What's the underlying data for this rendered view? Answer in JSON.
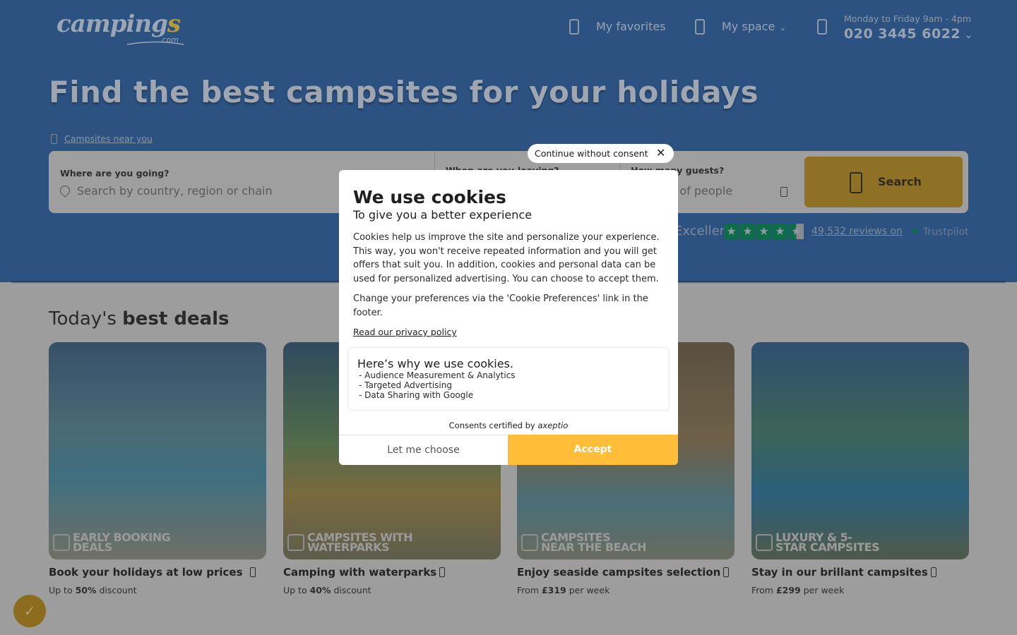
{
  "header": {
    "logo_main": "camping",
    "logo_s": "s",
    "logo_com": ".com",
    "favorites_label": "My favorites",
    "space_label": "My space",
    "hours": "Monday to Friday 9am - 4pm",
    "phone": "020 3445 6022"
  },
  "hero": {
    "title": "Find the best campsites for your holidays",
    "near_link": "Campsites near you"
  },
  "search": {
    "where_label": "Where are you going?",
    "where_placeholder": "Search by country, region or chain",
    "when_label": "When are you leaving?",
    "guests_label": "How many guests?",
    "guests_placeholder": "Number of people",
    "button_label": "Search"
  },
  "trust": {
    "rating_word": "Excellent",
    "reviews_text": "49,532 reviews on",
    "platform": "Trustpilot"
  },
  "deals": {
    "title_light": "Today's ",
    "title_bold": "best deals",
    "cards": [
      {
        "badge": "EARLY BOOKING DEALS",
        "title": "Book your holidays at low prices",
        "sub_prefix": "Up to ",
        "sub_value": "50%",
        "sub_suffix": " discount"
      },
      {
        "badge": "CAMPSITES WITH WATERPARKS",
        "title": "Camping with waterparks",
        "sub_prefix": "Up to ",
        "sub_value": "40%",
        "sub_suffix": " discount"
      },
      {
        "badge": "CAMPSITES NEAR THE BEACH",
        "title": "Enjoy seaside campsites selection",
        "sub_prefix": "From ",
        "sub_value": "£319",
        "sub_suffix": " per week"
      },
      {
        "badge": "LUXURY & 5-STAR CAMPSITES",
        "title": "Stay in our brillant campsites",
        "sub_prefix": "From ",
        "sub_value": "£299",
        "sub_suffix": " per week"
      }
    ]
  },
  "cookie": {
    "continue_label": "Continue without consent",
    "title": "We use cookies",
    "subtitle": "To give you a better experience",
    "body": "Cookies help us improve the site and personalize your experience. This way, you won't receive repeated information and you will get offers that suit you. In addition, cookies and personal data can be used for personalized advertising. You can choose to accept them.",
    "body2": "Change your preferences via the 'Cookie Preferences' link in the footer.",
    "privacy_link": "Read our privacy policy",
    "why_title": "Here’s why we use cookies.",
    "why_items": [
      "- Audience Measurement & Analytics",
      "- Targeted Advertising",
      "- Data Sharing with Google"
    ],
    "certified_prefix": "Consents certified by ",
    "certified_brand": "axeptio",
    "choose_label": "Let me choose",
    "accept_label": "Accept",
    "accent_color": "#ffbd38"
  }
}
